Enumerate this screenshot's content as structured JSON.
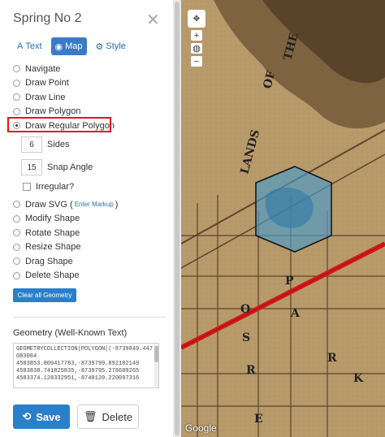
{
  "panel": {
    "title": "Spring No 2",
    "close_icon": "✕",
    "tabs": [
      {
        "icon": "A",
        "label": "Text"
      },
      {
        "icon": "◉",
        "label": "Map"
      },
      {
        "icon": "⚙",
        "label": "Style"
      }
    ],
    "options": [
      {
        "label": "Navigate",
        "selected": false
      },
      {
        "label": "Draw Point",
        "selected": false
      },
      {
        "label": "Draw Line",
        "selected": false
      },
      {
        "label": "Draw Polygon",
        "selected": false
      },
      {
        "label": "Draw Regular Polygon",
        "selected": true
      }
    ],
    "sides": {
      "value": "6",
      "label": "Sides"
    },
    "snap": {
      "value": "15",
      "label": "Snap Angle"
    },
    "irregular_label": "Irregular?",
    "options2": [
      {
        "label": "Draw SVG (",
        "link": "Enter Markup",
        "suffix": ")"
      },
      {
        "label": "Modify Shape"
      },
      {
        "label": "Rotate Shape"
      },
      {
        "label": "Resize Shape"
      },
      {
        "label": "Drag Shape"
      },
      {
        "label": "Delete Shape"
      }
    ],
    "clear_label": "Clear all Geometry",
    "geometry_label": "Geometry (Well-Known Text)",
    "geometry_text": "GEOMETRYCOLLECTION(POLYGON((-8739849.447083084\n4583853.800417783,-8739799.892182149\n4583838.741825835,-8739795.278689265\n4583374.128332951,-8740120.220097316",
    "save_label": "Save",
    "delete_label": "Delete"
  },
  "map": {
    "attribution": "Google",
    "pan_icon": "✥",
    "zoom_in": "+",
    "zoom_out": "−",
    "labels": [
      "LANDS",
      "OF",
      "THE",
      "P",
      "A",
      "R",
      "K",
      "E",
      "R",
      "S",
      "O"
    ],
    "colors": {
      "polygon_fill": "#4a9bc9",
      "line": "#d41a1a",
      "map_bg": "#b89a66"
    }
  }
}
